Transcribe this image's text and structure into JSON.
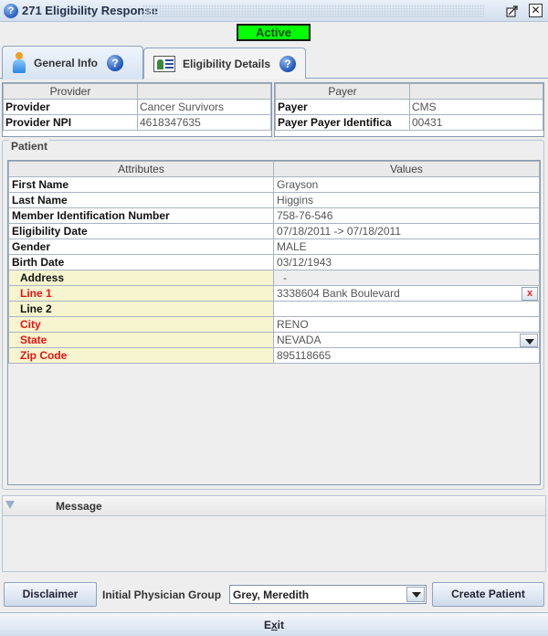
{
  "window": {
    "title": "271 Eligibility Response",
    "icon": "help-icon",
    "controls": [
      "maximize-icon",
      "close-icon"
    ]
  },
  "status": {
    "label": "Active",
    "color": "#00ff00"
  },
  "tabs": [
    {
      "label": "General Info",
      "icon": "person-icon",
      "help_icon": "help-icon",
      "active": true
    },
    {
      "label": "Eligibility Details",
      "icon": "id-card-icon",
      "help_icon": "help-icon",
      "active": false
    }
  ],
  "provider": {
    "header": "Provider",
    "rows": [
      {
        "label": "Provider",
        "value": "Cancer Survivors"
      },
      {
        "label": "Provider NPI",
        "value": "4618347635"
      }
    ]
  },
  "payer": {
    "header": "Payer",
    "rows": [
      {
        "label": "Payer",
        "value": "CMS"
      },
      {
        "label": "Payer Payer Identifica",
        "value": "00431"
      }
    ]
  },
  "patient": {
    "legend": "Patient",
    "columns": [
      "Attributes",
      "Values"
    ],
    "rows": [
      {
        "label": "First Name",
        "value": "Grayson"
      },
      {
        "label": "Last Name",
        "value": "Higgins"
      },
      {
        "label": "Member Identification Number",
        "value": "758-76-546"
      },
      {
        "label": "Eligibility Date",
        "value": "07/18/2011 -> 07/18/2011"
      },
      {
        "label": "Gender",
        "value": "MALE"
      },
      {
        "label": "Birth Date",
        "value": "03/12/1943"
      }
    ],
    "address": {
      "label": "Address",
      "value": "-",
      "fields": [
        {
          "label": "Line 1",
          "value": "3338604 Bank Boulevard",
          "required": true,
          "clear_button": "x"
        },
        {
          "label": "Line 2",
          "value": "",
          "required": false
        },
        {
          "label": "City",
          "value": "RENO",
          "required": true
        },
        {
          "label": "State",
          "value": "NEVADA",
          "required": true,
          "dropdown": true
        },
        {
          "label": "Zip Code",
          "value": "895118665",
          "required": true
        }
      ]
    },
    "required_color": "#ee1111"
  },
  "message": {
    "label": "Message"
  },
  "footer": {
    "disclaimer_label": "Disclaimer",
    "physician_group_label": "Initial Physician Group",
    "physician_group_value": "Grey, Meredith",
    "create_patient_label": "Create Patient",
    "exit_label_pre": "E",
    "exit_label_mnemonic": "x",
    "exit_label_post": "it"
  }
}
